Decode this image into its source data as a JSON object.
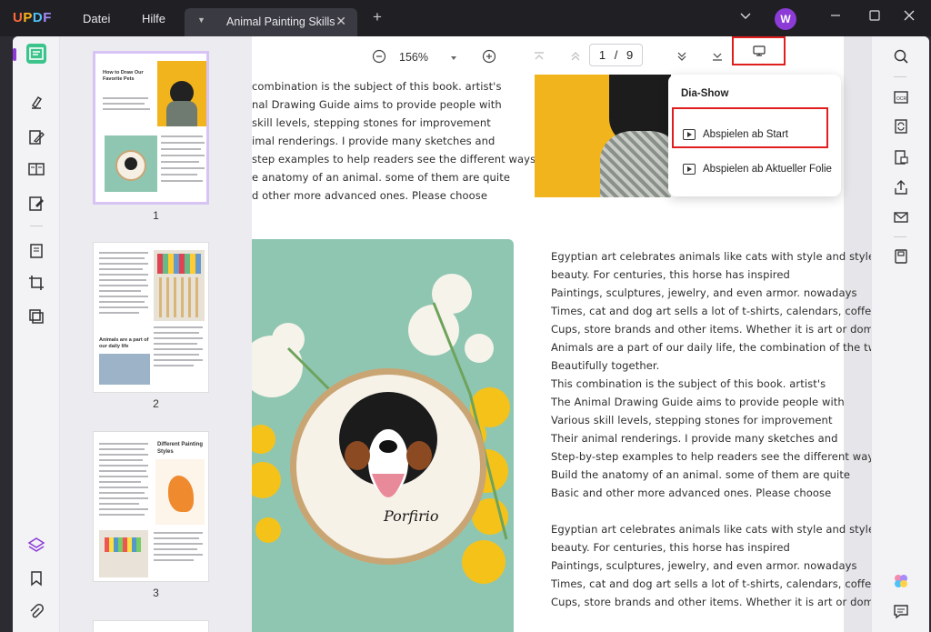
{
  "app": {
    "logo": "UPDF"
  },
  "menu": {
    "file": "Datei",
    "help": "Hilfe"
  },
  "tab": {
    "title": "Animal Painting Skills",
    "close": "✕",
    "add": "+"
  },
  "user": {
    "initial": "W"
  },
  "toolbar": {
    "zoom": "156%",
    "page_current": "1",
    "page_sep": "/",
    "page_total": "9"
  },
  "thumbnails": [
    {
      "number": "1",
      "title": "How to Draw Our Favorite Pets",
      "selected": true
    },
    {
      "number": "2",
      "title": "Animals are a part of our daily life"
    },
    {
      "number": "3",
      "title": "Different Painting Styles"
    }
  ],
  "dropdown": {
    "title": "Dia-Show",
    "play_start": "Abspielen ab Start",
    "play_current": "Abspielen ab Aktueller Folie"
  },
  "doc": {
    "top_left_lines": [
      "combination is the subject of this book. artist's",
      "nal Drawing Guide aims to provide people with",
      "skill levels, stepping stones for improvement",
      "imal renderings. I provide many sketches and",
      "step examples to help readers see the different ways",
      "e anatomy of an animal. some of them are quite",
      "d other more advanced ones. Please choose"
    ],
    "right_lines": [
      "Egyptian art celebrates animals like cats with style and style",
      "beauty. For centuries, this horse has inspired",
      "Paintings, sculptures, jewelry, and even armor. nowadays",
      "Times, cat and dog art sells a lot of t-shirts, calendars, coffee",
      "Cups, store brands and other items. Whether it is art or domestic",
      "Animals are a part of our daily life, the combination of the two",
      "Beautifully together.",
      "This combination is the subject of this book. artist's",
      "The Animal Drawing Guide aims to provide people with",
      "Various skill levels, stepping stones for improvement",
      "Their animal renderings. I provide many sketches and",
      "Step-by-step examples to help readers see the different ways",
      "Build the anatomy of an animal. some of them are quite",
      "Basic and other more advanced ones. Please choose",
      "",
      "Egyptian art celebrates animals like cats with style and style",
      "beauty. For centuries, this horse has inspired",
      "Paintings, sculptures, jewelry, and even armor. nowadays",
      "Times, cat and dog art sells a lot of t-shirts, calendars, coffee",
      "Cups, store brands and other items. Whether it is art or domestic"
    ],
    "embroidery_text": "Porfirio"
  },
  "colors": {
    "accent": "#e01e1e",
    "brand_purple": "#8c3bd6",
    "yellow": "#f2b41c",
    "mint": "#8fc6b2"
  }
}
